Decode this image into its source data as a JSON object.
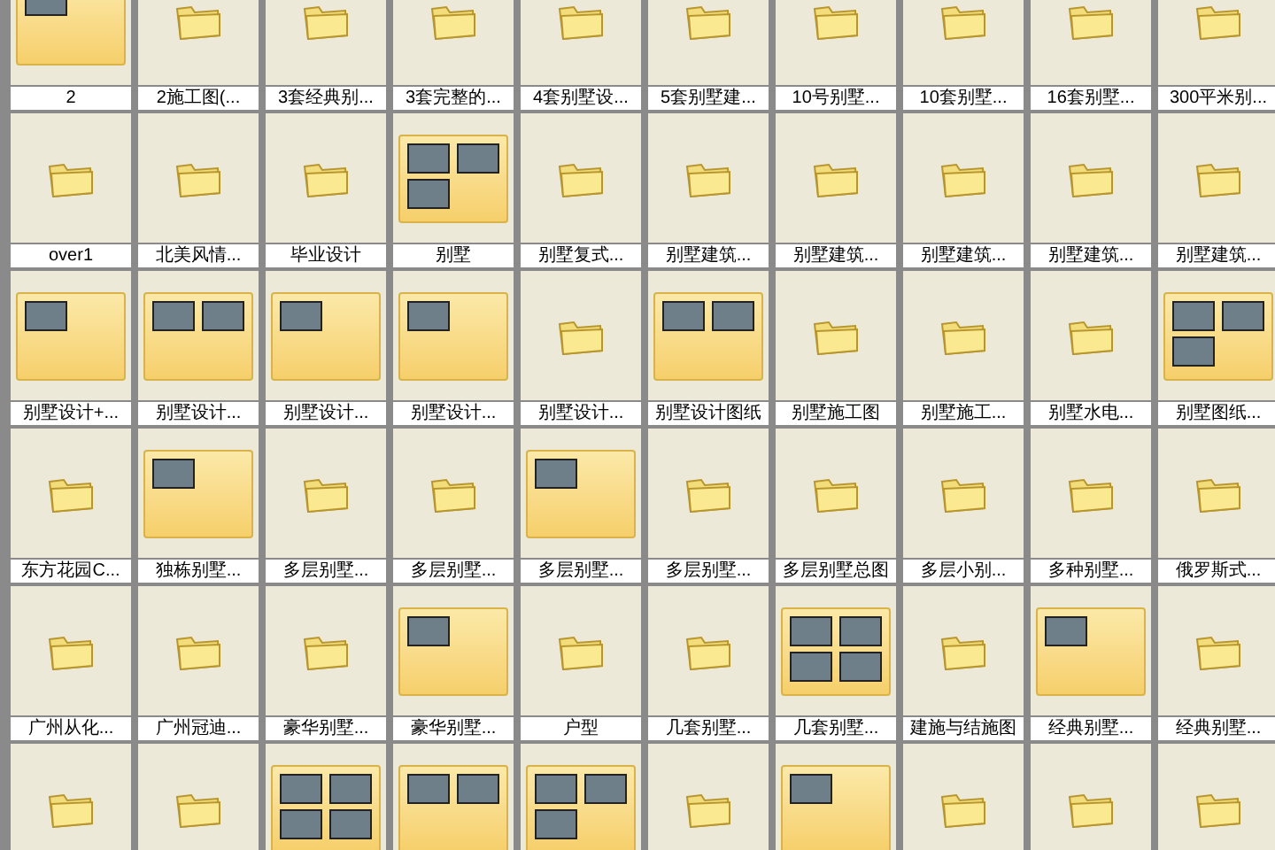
{
  "folders": [
    {
      "label": "2",
      "kind": "one-photo"
    },
    {
      "label": "2施工图(...",
      "kind": "folder"
    },
    {
      "label": "3套经典别...",
      "kind": "folder"
    },
    {
      "label": "3套完整的...",
      "kind": "folder"
    },
    {
      "label": "4套别墅设...",
      "kind": "folder"
    },
    {
      "label": "5套别墅建...",
      "kind": "folder"
    },
    {
      "label": "10号别墅...",
      "kind": "folder"
    },
    {
      "label": "10套别墅...",
      "kind": "folder"
    },
    {
      "label": "16套别墅...",
      "kind": "folder"
    },
    {
      "label": "300平米别...",
      "kind": "folder"
    },
    {
      "label": "over1",
      "kind": "folder"
    },
    {
      "label": "北美风情...",
      "kind": "folder"
    },
    {
      "label": "毕业设计",
      "kind": "folder"
    },
    {
      "label": "别墅",
      "kind": "three-photos"
    },
    {
      "label": "别墅复式...",
      "kind": "folder"
    },
    {
      "label": "别墅建筑...",
      "kind": "folder"
    },
    {
      "label": "别墅建筑...",
      "kind": "folder"
    },
    {
      "label": "别墅建筑...",
      "kind": "folder"
    },
    {
      "label": "别墅建筑...",
      "kind": "folder"
    },
    {
      "label": "别墅建筑...",
      "kind": "folder"
    },
    {
      "label": "别墅设计+...",
      "kind": "one-photo"
    },
    {
      "label": "别墅设计...",
      "kind": "two-photos"
    },
    {
      "label": "别墅设计...",
      "kind": "one-photo"
    },
    {
      "label": "别墅设计...",
      "kind": "one-photo"
    },
    {
      "label": "别墅设计...",
      "kind": "folder"
    },
    {
      "label": "别墅设计图纸",
      "kind": "two-photos"
    },
    {
      "label": "别墅施工图",
      "kind": "folder"
    },
    {
      "label": "别墅施工...",
      "kind": "folder"
    },
    {
      "label": "别墅水电...",
      "kind": "folder"
    },
    {
      "label": "别墅图纸...",
      "kind": "three-photos"
    },
    {
      "label": "东方花园C...",
      "kind": "folder"
    },
    {
      "label": "独栋别墅...",
      "kind": "one-photo"
    },
    {
      "label": "多层别墅...",
      "kind": "folder"
    },
    {
      "label": "多层别墅...",
      "kind": "folder"
    },
    {
      "label": "多层别墅...",
      "kind": "one-photo"
    },
    {
      "label": "多层别墅...",
      "kind": "folder"
    },
    {
      "label": "多层别墅总图",
      "kind": "folder"
    },
    {
      "label": "多层小别...",
      "kind": "folder"
    },
    {
      "label": "多种别墅...",
      "kind": "folder"
    },
    {
      "label": "俄罗斯式...",
      "kind": "folder"
    },
    {
      "label": "广州从化...",
      "kind": "folder"
    },
    {
      "label": "广州冠迪...",
      "kind": "folder"
    },
    {
      "label": "豪华别墅...",
      "kind": "folder"
    },
    {
      "label": "豪华别墅...",
      "kind": "one-photo"
    },
    {
      "label": "户型",
      "kind": "folder"
    },
    {
      "label": "几套别墅...",
      "kind": "folder"
    },
    {
      "label": "几套别墅...",
      "kind": "four-photos"
    },
    {
      "label": "建施与结施图",
      "kind": "folder"
    },
    {
      "label": "经典别墅...",
      "kind": "one-photo"
    },
    {
      "label": "经典别墅...",
      "kind": "folder"
    },
    {
      "kind": "folder"
    },
    {
      "kind": "folder"
    },
    {
      "kind": "four-photos"
    },
    {
      "kind": "two-photos"
    },
    {
      "kind": "three-photos"
    },
    {
      "kind": "folder"
    },
    {
      "kind": "one-photo"
    },
    {
      "kind": "folder"
    },
    {
      "kind": "folder"
    },
    {
      "kind": "folder"
    }
  ]
}
